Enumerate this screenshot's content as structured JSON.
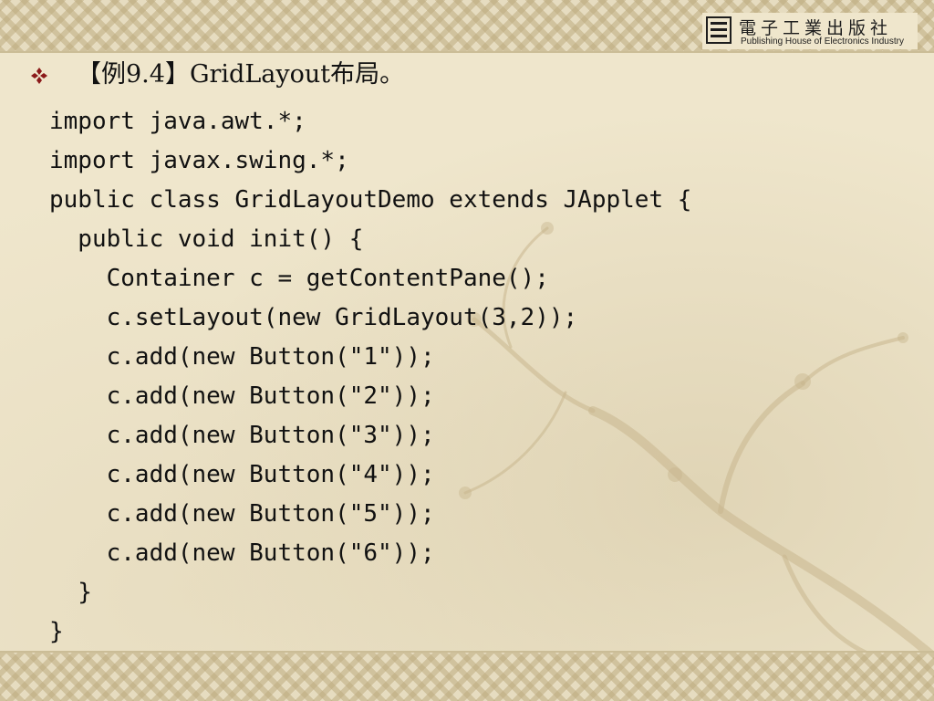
{
  "slide": {
    "publisher": {
      "name_cn": "電子工業出版社",
      "name_en": "Publishing House of Electronics Industry"
    },
    "title": "【例9.4】GridLayout布局。",
    "code_lines": [
      "import java.awt.*;",
      "import javax.swing.*;",
      "public class GridLayoutDemo extends JApplet {",
      "  public void init() {",
      "    Container c = getContentPane();",
      "    c.setLayout(new GridLayout(3,2));",
      "    c.add(new Button(\"1\"));",
      "    c.add(new Button(\"2\"));",
      "    c.add(new Button(\"3\"));",
      "    c.add(new Button(\"4\"));",
      "    c.add(new Button(\"5\"));",
      "    c.add(new Button(\"6\"));",
      "  }",
      "}"
    ]
  },
  "colors": {
    "background": "#efe6cc",
    "text": "#111111",
    "bullet": "#8b1a1a",
    "border": "#cbbd97"
  },
  "icons": {
    "bullet": "diamond-bullet-icon",
    "logo": "publisher-logo-icon"
  }
}
